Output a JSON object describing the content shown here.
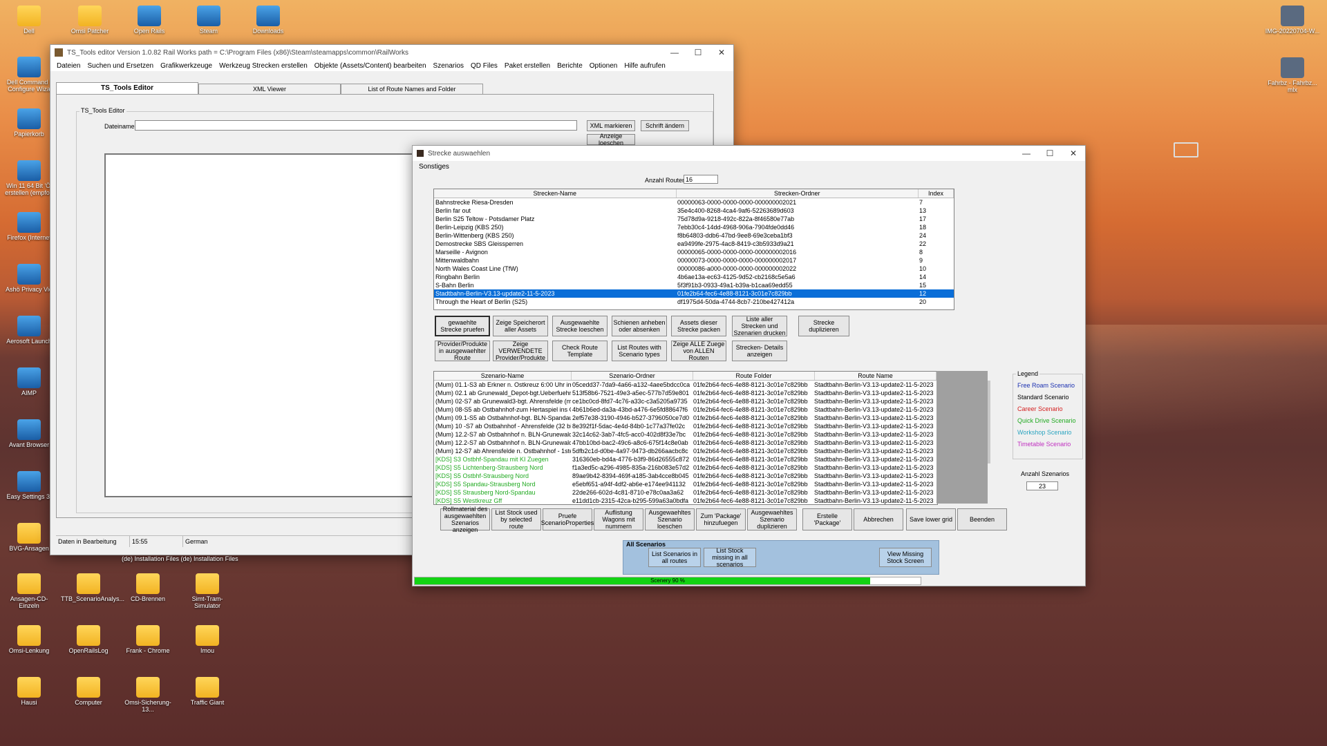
{
  "desktop": {
    "left_icons": [
      {
        "label": "Dell",
        "icon": "folder-icon"
      },
      {
        "label": "Omsi Patcher",
        "icon": "folder-icon"
      },
      {
        "label": "Open Rails",
        "icon": "app-icon"
      },
      {
        "label": "Steam",
        "icon": "steam-icon"
      },
      {
        "label": "Downloads",
        "icon": "download-icon"
      }
    ],
    "col1": [
      {
        "label": "Dell Command | Configure Wiza",
        "icon": "app-icon"
      },
      {
        "label": "Papierkorb",
        "icon": "recycle-bin-icon"
      },
      {
        "label": "Win 11 64 Bit 'Ö' erstellen (empfoh",
        "icon": "edge-icon"
      },
      {
        "label": "Firefox (Internet",
        "icon": "firefox-icon"
      },
      {
        "label": "Ashö Privacy Vie",
        "icon": "app-icon"
      },
      {
        "label": "Aerosoft Launch",
        "icon": "app-icon"
      },
      {
        "label": "AIMP",
        "icon": "app-icon"
      },
      {
        "label": "Avant Browser",
        "icon": "app-icon"
      },
      {
        "label": "Easy Settings 3!",
        "icon": "app-icon"
      },
      {
        "label": "BVG-Ansagen",
        "icon": "folder-icon"
      }
    ],
    "bottom_rows": [
      [
        "Ansagen-CD-Einzeln",
        "TTB_ScenarioAnalys...",
        "CD-Brennen",
        "Simt-Tram-Simulator"
      ],
      [
        "Omsi-Lenkung",
        "OpenRailsLog",
        "Frank - Chrome",
        "Imou"
      ],
      [
        "Hausi",
        "Computer",
        "Omsi-Sicherung-13...",
        "Traffic Giant"
      ]
    ],
    "right_icons": [
      {
        "label": "IMG-20220704-W...",
        "icon": "image-icon"
      },
      {
        "label": "Fahrbz - Fahrbz... mlx",
        "icon": "image-icon"
      }
    ],
    "installation_text": "(de) Installation Files  (de) Installation Files"
  },
  "ts_editor": {
    "title": "TS_Tools editor  Version 1.0.82  Rail Works path = C:\\Program Files (x86)\\Steam\\steamapps\\common\\RailWorks",
    "menu": [
      "Dateien",
      "Suchen und Ersetzen",
      "Grafikwerkzeuge",
      "Werkzeug Strecken erstellen",
      "Objekte (Assets/Content) bearbeiten",
      "Szenarios",
      "QD Files",
      "Paket erstellen",
      "Berichte",
      "Optionen",
      "Hilfe aufrufen"
    ],
    "tabs": [
      "TS_Tools Editor",
      "XML Viewer",
      "List of Route Names and Folder"
    ],
    "group_label": "TS_Tools Editor",
    "filename_label": "Dateiname:",
    "filename_value": "",
    "btn_xml": "XML markieren",
    "btn_font": "Schrift ändern",
    "btn_clear": "Anzeige loeschen",
    "status": [
      "Daten in Bearbeitung",
      "15:55",
      "German"
    ]
  },
  "strecke": {
    "title": "Strecke auswaehlen",
    "menu": "Sonstiges",
    "count_label": "Anzahl Routen",
    "count_value": "16",
    "route_columns": [
      "Strecken-Name",
      "Strecken-Ordner",
      "Index"
    ],
    "routes": [
      [
        "Bahnstrecke Riesa-Dresden",
        "00000063-0000-0000-0000-000000002021",
        "7"
      ],
      [
        "Berlin far out",
        "35e4c400-8268-4ca4-9af6-52263689d603",
        "13"
      ],
      [
        "Berlin S25 Teltow - Potsdamer Platz",
        "75d78d9a-9218-492c-822a-8f46580e77ab",
        "17"
      ],
      [
        "Berlin-Leipzig (KBS 250)",
        "7ebb30c4-14dd-4968-906a-7904fde0dd46",
        "18"
      ],
      [
        "Berlin-Wittenberg (KBS 250)",
        "f8b64803-ddb6-47bd-9ee8-69e3ceba1bf3",
        "24"
      ],
      [
        "Demostrecke SBS Gleissperren",
        "ea9499fe-2975-4ac8-8419-c3b5933d9a21",
        "22"
      ],
      [
        "Marseille - Avignon",
        "00000065-0000-0000-0000-000000002016",
        "8"
      ],
      [
        "Mittenwaldbahn",
        "00000073-0000-0000-0000-000000002017",
        "9"
      ],
      [
        "North Wales Coast Line (TfW)",
        "00000086-a000-0000-0000-000000002022",
        "10"
      ],
      [
        "Ringbahn Berlin",
        "4b6ae13a-ec63-4125-9d52-cb2168c5e5a6",
        "14"
      ],
      [
        "S-Bahn Berlin",
        "5f3f91b3-0933-49a1-b39a-b1caa69edd55",
        "15"
      ],
      [
        "Stadtbahn-Berlin-V3.13-update2-11-5-2023",
        "01fe2b64-fec6-4e88-8121-3c01e7c829bb",
        "12"
      ],
      [
        "Through the Heart of Berlin (S25)",
        "df1975d4-50da-4744-8cb7-210be427412a",
        "20"
      ]
    ],
    "selected_route_index": 11,
    "buttons_row1": [
      "gewaehlte Strecke pruefen",
      "Zeige Speicherort aller Assets",
      "Ausgewaehlte Strecke loeschen",
      "Schienen anheben oder absenken",
      "Assets dieser Strecke packen",
      "Liste aller Strecken und Szenarien drucken",
      "Strecke duplizieren"
    ],
    "buttons_row2": [
      "Provider/Produkte in ausgewaehlter Route",
      "Zeige VERWENDETE Provider/Produkte",
      "Check Route Template",
      "List Routes with Scenario types",
      "Zeige ALLE Zuege von ALLEN Routen",
      "Strecken- Details anzeigen"
    ],
    "scenario_columns": [
      "Szenario-Name",
      "Szenario-Ordner",
      "Route Folder",
      "Route Name"
    ],
    "scenarios": [
      [
        "(Mum) 01.1-S3 ab Erkner n. Ostkreuz 6:00 Uhr im Rege",
        "05cedd37-7da9-4a66-a132-4aee5bdcc0ca",
        "01fe2b64-fec6-4e88-8121-3c01e7c829bb",
        "Stadtbahn-Berlin-V3.13-update2-11-5-2023",
        "standard"
      ],
      [
        "(Mum) 02.1 ab Grunewald_Depot-bgt.Ueberfuehrung ei",
        "513f58b6-7521-49e3-a5ec-577b7d59e801",
        "01fe2b64-fec6-4e88-8121-3c01e7c829bb",
        "Stadtbahn-Berlin-V3.13-update2-11-5-2023",
        "standard"
      ],
      [
        "(Mum) 02-S7 ab Grunewald3-bgt. Ahrensfelde (mitags)",
        "ce1bc0cd-8fd7-4c76-a33c-c3a5205a9735",
        "01fe2b64-fec6-4e88-8121-3c01e7c829bb",
        "Stadtbahn-Berlin-V3.13-update2-11-5-2023",
        "standard"
      ],
      [
        "(Mum) 08-S5 ab Ostbahnhof-zum  Hertaspiel ins Olympi",
        "4b61b6ed-da3a-43bd-a476-6e5fd88647f6",
        "01fe2b64-fec6-4e88-8121-3c01e7c829bb",
        "Stadtbahn-Berlin-V3.13-update2-11-5-2023",
        "standard"
      ],
      [
        "(Mum) 09.1-S5 ab Ostbahnhof-bgt. BLN-Spandau ( 32",
        "2ef57e38-3190-4946-b527-3796050ce7d0",
        "01fe2b64-fec6-4e88-8121-3c01e7c829bb",
        "Stadtbahn-Berlin-V3.13-update2-11-5-2023",
        "standard"
      ],
      [
        "(Mum) 10 -S7 ab Ostbahnhof - Ahrensfelde (32 bit)",
        "8e392f1f-5dac-4e4d-84b0-1c77a37fe02c",
        "01fe2b64-fec6-4e88-8121-3c01e7c829bb",
        "Stadtbahn-Berlin-V3.13-update2-11-5-2023",
        "standard"
      ],
      [
        "(Mum) 12.2-S7 ab Ostbahnhof n. BLN-Grunewald - 2tes",
        "32c14c62-3ab7-4fc5-acc0-402d8f33e7bc",
        "01fe2b64-fec6-4e88-8121-3c01e7c829bb",
        "Stadtbahn-Berlin-V3.13-update2-11-5-2023",
        "standard"
      ],
      [
        "(Mum) 12.2-S7 ab Ostbahnhof n. BLN-Grunewald - S7 E",
        "47bb10bd-bac2-49c6-a8c6-675f14c8e0ab",
        "01fe2b64-fec6-4e88-8121-3c01e7c829bb",
        "Stadtbahn-Berlin-V3.13-update2-11-5-2023",
        "standard"
      ],
      [
        "(Mum) 12-S7 ab Ahrensfelde n. Ostbahnhof - 1stes Teil",
        "5dfb2c1d-d0be-4a97-9473-db266aacbc8c",
        "01fe2b64-fec6-4e88-8121-3c01e7c829bb",
        "Stadtbahn-Berlin-V3.13-update2-11-5-2023",
        "standard"
      ],
      [
        "[KDS] S3 Ostbhf-Spandau mit KI Zuegen",
        "316360eb-bd4a-4776-b3f9-86d26555c872",
        "01fe2b64-fec6-4e88-8121-3c01e7c829bb",
        "Stadtbahn-Berlin-V3.13-update2-11-5-2023",
        "quick"
      ],
      [
        "[KDS] S5 Lichtenberg-Strausberg Nord",
        "f1a3ed5c-a296-4985-835a-216b083e57d2",
        "01fe2b64-fec6-4e88-8121-3c01e7c829bb",
        "Stadtbahn-Berlin-V3.13-update2-11-5-2023",
        "quick"
      ],
      [
        "[KDS] S5 Ostbhf-Strausberg Nord",
        "89ae9b42-8394-469f-a185-3ab4cce8b045",
        "01fe2b64-fec6-4e88-8121-3c01e7c829bb",
        "Stadtbahn-Berlin-V3.13-update2-11-5-2023",
        "quick"
      ],
      [
        "[KDS] S5 Spandau-Strausberg Nord",
        "e5ebf651-a94f-4df2-ab6e-e174ee941132",
        "01fe2b64-fec6-4e88-8121-3c01e7c829bb",
        "Stadtbahn-Berlin-V3.13-update2-11-5-2023",
        "quick"
      ],
      [
        "[KDS] S5 Strausberg Nord-Spandau",
        "22de266-602d-4c81-8710-e78c0aa3a62",
        "01fe2b64-fec6-4e88-8121-3c01e7c829bb",
        "Stadtbahn-Berlin-V3.13-update2-11-5-2023",
        "quick"
      ],
      [
        "[KDS] S5 Westkreuz Gff",
        "e11dd1cb-2315-42ca-b295-599a63a0bdfa",
        "01fe2b64-fec6-4e88-8121-3c01e7c829bb",
        "Stadtbahn-Berlin-V3.13-update2-11-5-2023",
        "quick"
      ]
    ],
    "legend_title": "Legend",
    "legend": [
      {
        "label": "Free Roam Scenario",
        "color": "#1a2fb0"
      },
      {
        "label": "Standard Scenario",
        "color": "#000000"
      },
      {
        "label": "Career Scenario",
        "color": "#d42020"
      },
      {
        "label": "Quick Drive Scenario",
        "color": "#22aa22"
      },
      {
        "label": "Workshop Scenario",
        "color": "#2aa4c0"
      },
      {
        "label": "Timetable Scenario",
        "color": "#c030c0"
      }
    ],
    "scen_count_label": "Anzahl Szenarios",
    "scen_count_value": "23",
    "bottom_buttons": [
      "Rollmaterial des ausgewaehlten Szenarios anzeigen",
      "List Stock used by selected route",
      "Pruefe ScenarioProperties",
      "Auflistung Wagons mit nummern",
      "Ausgewaehltes Szenario loeschen",
      "Zum 'Package' hinzufuegen",
      "Ausgewaehltes Szenario duplizieren",
      "Erstelle 'Package'",
      "Abbrechen",
      "Save lower grid",
      "Beenden"
    ],
    "all_scen_label": "All Scenarios",
    "all_buttons": [
      "List Scenarios in all routes",
      "List Stock missing in all scenarios",
      "View Missing Stock Screen"
    ],
    "progress_label": "Scenery 90 %",
    "progress_value": 0.9
  }
}
